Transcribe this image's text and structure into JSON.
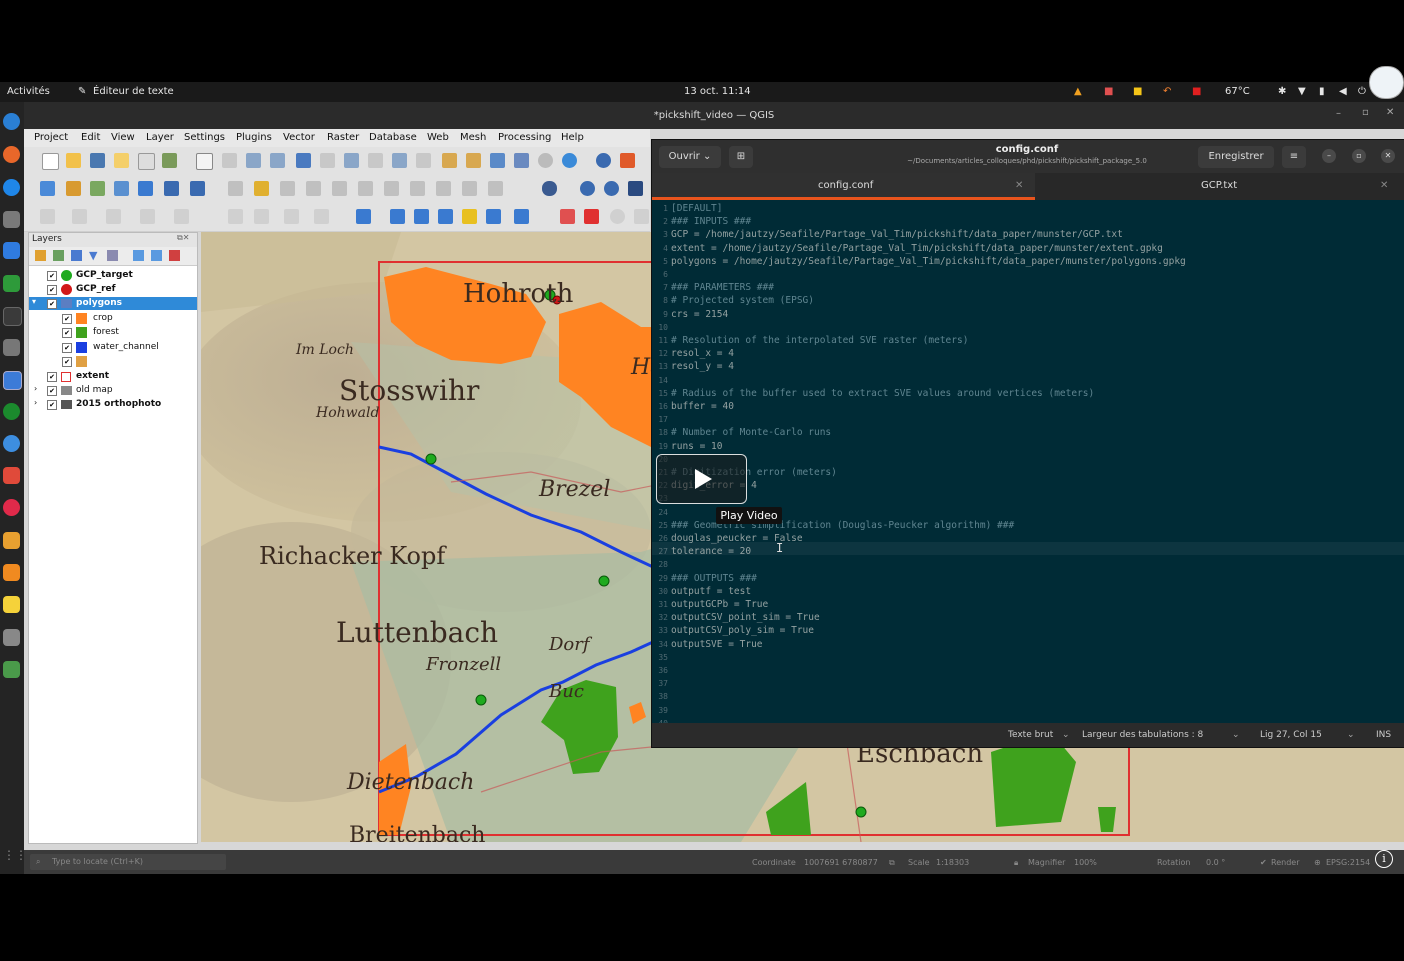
{
  "topbar": {
    "activities": "Activités",
    "app_name": "Éditeur de texte",
    "clock": "13 oct.  11:14",
    "temperature": "67°C"
  },
  "qgis": {
    "title": "*pickshift_video — QGIS",
    "menu": [
      "Project",
      "Edit",
      "View",
      "Layer",
      "Settings",
      "Plugins",
      "Vector",
      "Raster",
      "Database",
      "Web",
      "Mesh",
      "Processing",
      "Help"
    ],
    "layers_panel": {
      "title": "Layers",
      "items": [
        {
          "label": "GCP_target",
          "bold": true,
          "color": "#1faa1f",
          "kind": "point"
        },
        {
          "label": "GCP_ref",
          "bold": true,
          "color": "#d11818",
          "kind": "point"
        },
        {
          "label": "polygons",
          "bold": true,
          "color": "#5b7ec2",
          "kind": "group-selected"
        },
        {
          "label": "crop",
          "bold": false,
          "color": "#ff8422",
          "kind": "class"
        },
        {
          "label": "forest",
          "bold": false,
          "color": "#3fa21d",
          "kind": "class"
        },
        {
          "label": "water_channel",
          "bold": false,
          "color": "#1a3fe0",
          "kind": "class"
        },
        {
          "label": "",
          "bold": false,
          "color": "#e0a043",
          "kind": "class"
        },
        {
          "label": "extent",
          "bold": true,
          "color": "#e03030",
          "kind": "outline"
        },
        {
          "label": "old map",
          "bold": false,
          "color": "#888888",
          "kind": "raster"
        },
        {
          "label": "2015 orthophoto",
          "bold": true,
          "color": "#555555",
          "kind": "raster"
        }
      ]
    },
    "map_labels": [
      "Hohroth",
      "Stosswihr",
      "Brezel",
      "Richacker Kopf",
      "Luttenbach",
      "Dietenbach",
      "Breitenbach",
      "Eschbach",
      "Im Loch",
      "Hohwald",
      "Dorf",
      "Fronzell",
      "Buc",
      "Ha"
    ],
    "statusbar": {
      "locate_placeholder": "Type to locate (Ctrl+K)",
      "coordinate_label": "Coordinate",
      "coordinate_value": "1007691 6780877",
      "scale_label": "Scale",
      "scale_value": "1:18303",
      "magnifier_label": "Magnifier",
      "magnifier_value": "100%",
      "rotation_label": "Rotation",
      "rotation_value": "0.0 °",
      "render_label": "Render",
      "crs_label": "EPSG:2154"
    }
  },
  "editor": {
    "open_label": "Ouvrir",
    "file_title": "config.conf",
    "file_path": "~/Documents/articles_colloques/phd/pickshift/pickshift_package_5.0",
    "save_label": "Enregistrer",
    "tabs": [
      {
        "label": "config.conf",
        "active": true
      },
      {
        "label": "GCP.txt",
        "active": false
      }
    ],
    "lines": [
      "[DEFAULT]",
      "### INPUTS ###",
      "GCP = /home/jautzy/Seafile/Partage_Val_Tim/pickshift/data_paper/munster/GCP.txt",
      "extent = /home/jautzy/Seafile/Partage_Val_Tim/pickshift/data_paper/munster/extent.gpkg",
      "polygons = /home/jautzy/Seafile/Partage_Val_Tim/pickshift/data_paper/munster/polygons.gpkg",
      "",
      "### PARAMETERS ###",
      "# Projected system (EPSG)",
      "crs = 2154",
      "",
      "# Resolution of the interpolated SVE raster (meters)",
      "resol_x = 4",
      "resol_y = 4",
      "",
      "# Radius of the buffer used to extract SVE values around vertices (meters)",
      "buffer = 40",
      "",
      "# Number of Monte-Carlo runs",
      "runs = 10",
      "",
      "# Digitization error (meters)",
      "digit_error = 4",
      "",
      "",
      "### Geometric simplification (Douglas-Peucker algorithm) ###",
      "douglas_peucker = False",
      "tolerance = 20",
      "",
      "### OUTPUTS ###",
      "outputf = test",
      "outputGCPb = True",
      "outputCSV_point_sim = True",
      "outputCSV_poly_sim = True",
      "outputSVE = True",
      "",
      "",
      "",
      "",
      "",
      ""
    ],
    "footer": {
      "syntax": "Texte brut",
      "tab_width": "Largeur des tabulations : 8",
      "position": "Lig 27, Col 15",
      "mode": "INS"
    }
  },
  "video": {
    "play_tooltip": "Play Video"
  }
}
